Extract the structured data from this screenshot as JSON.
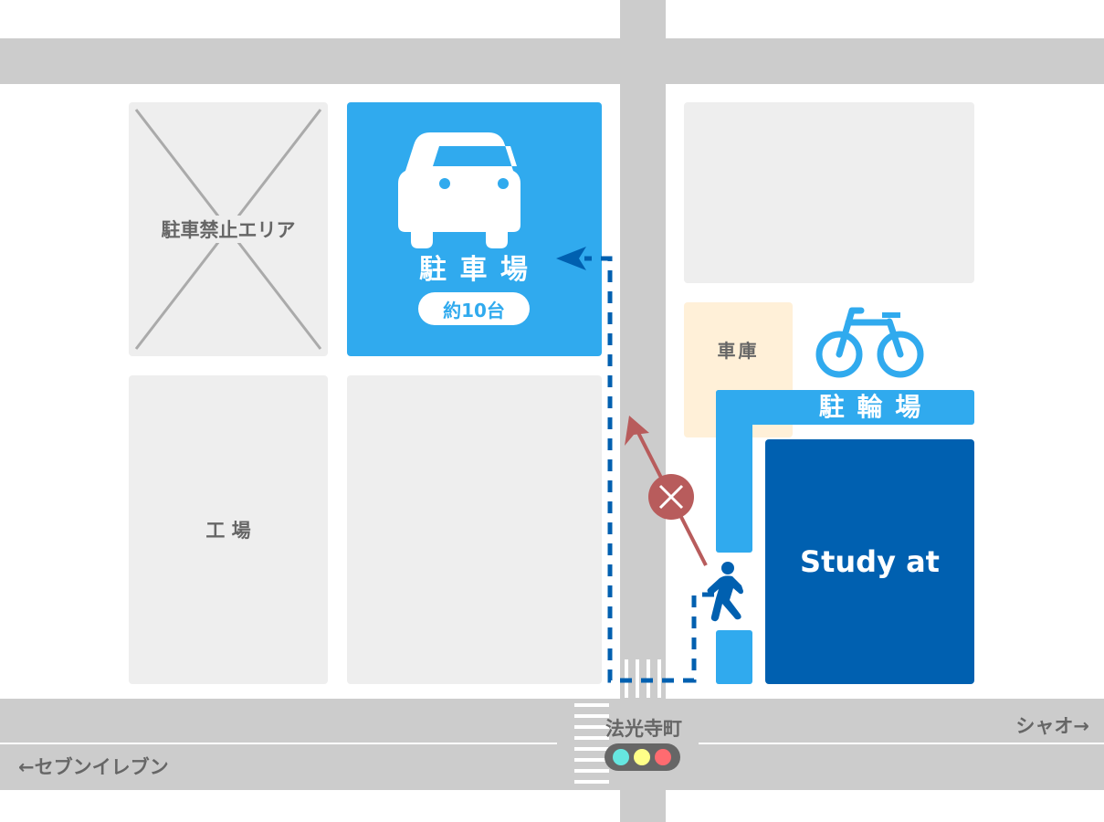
{
  "map": {
    "blocks": {
      "no_parking": {
        "label": "駐車禁止エリア"
      },
      "factory": {
        "label": "工 場"
      },
      "garage": {
        "label": "車庫"
      }
    },
    "parking": {
      "label": "駐 車 場",
      "capacity": "約10台",
      "icon": "car-icon"
    },
    "bicycle_parking": {
      "label": "駐 輪 場",
      "icon": "bicycle-icon"
    },
    "destination": {
      "label": "Study at"
    },
    "intersection": {
      "name": "法光寺町",
      "traffic_light_colors": [
        "#66e6e0",
        "#ffff88",
        "#ff6b70"
      ]
    },
    "directions": {
      "left": "←セブンイレブン",
      "right": "シャオ→"
    },
    "routes": {
      "recommended_color": "#0060b0",
      "prohibited_color": "#b85c5c"
    },
    "colors": {
      "road": "#cccccc",
      "block": "#eeeeee",
      "parking": "#30aaee",
      "destination": "#0060b0",
      "garage": "#fff0d8",
      "text": "#666666"
    }
  }
}
